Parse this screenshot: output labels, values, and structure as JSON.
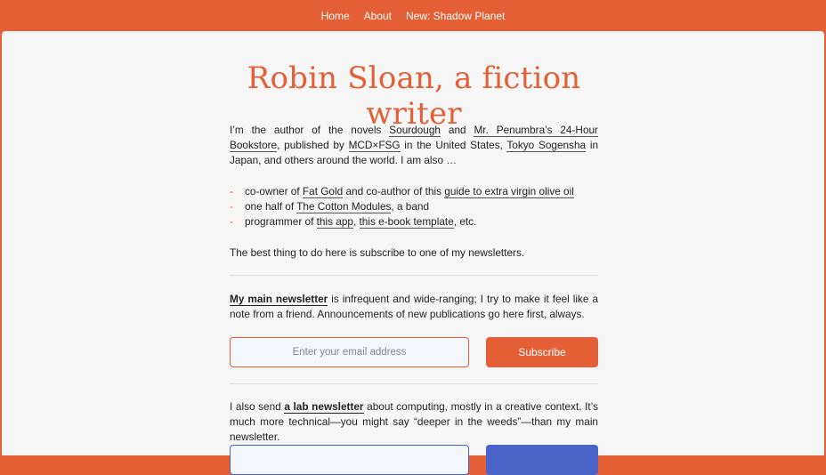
{
  "nav": {
    "items": [
      "Home",
      "About",
      "New: Shadow Planet"
    ]
  },
  "title": "Robin Sloan, a fiction writer",
  "intro": {
    "t1": "I’m the author of the novels ",
    "l1": "Sourdough",
    "t2": " and ",
    "l2": "Mr. Penumbra’s 24-Hour Bookstore",
    "t3": ", published by ",
    "l3": "MCD×FSG",
    "t4": " in the United States, ",
    "l4": "Tokyo Sogensha",
    "t5": " in Japan, and others around the world. I am also …"
  },
  "list": [
    {
      "t1": "co-owner of ",
      "l1": "Fat Gold",
      "t2": " and co-author of this ",
      "l2": "guide to extra virgin olive oil",
      "t3": ""
    },
    {
      "t1": "one half of ",
      "l1": "The Cotton Modules",
      "t2": ", a band",
      "l2": "",
      "t3": ""
    },
    {
      "t1": "programmer of ",
      "l1": "this app",
      "t2": ", ",
      "l2": "this e-book template",
      "t3": ", etc."
    }
  ],
  "best": "The best thing to do here is subscribe to one of my newsletters.",
  "main_newsletter": {
    "link": "My main newsletter",
    "text": " is infrequent and wide-ranging; I try to make it feel like a note from a friend. Announcements of new publications go here first, always.",
    "placeholder": "Enter your email address",
    "button": "Subscribe"
  },
  "lab_newsletter": {
    "t1": "I also send ",
    "link": "a lab newsletter",
    "t2": " about computing, mostly in a creative context. It’s much more technical—you might say “deeper in the weeds”—than my main newsletter."
  },
  "colors": {
    "accent": "#e45f35",
    "lab": "#4a63c8",
    "panel": "#f6f6f6"
  }
}
